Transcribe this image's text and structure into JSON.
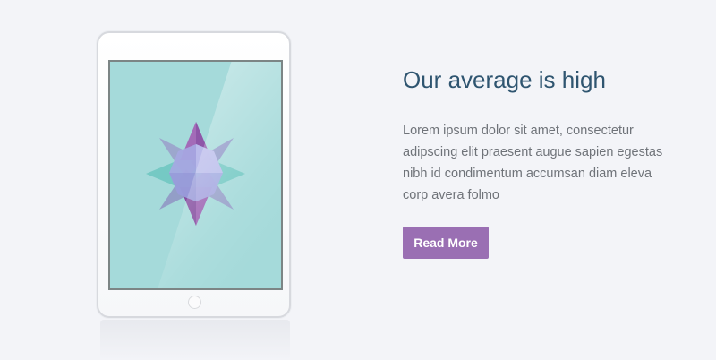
{
  "feature": {
    "heading": "Our average is high",
    "body": "Lorem ipsum dolor sit amet, consectetur adipscing elit praesent augue sapien egestas nibh id condimentum accumsan diam eleva corp avera folmo",
    "cta_label": "Read More"
  },
  "device": {
    "icon": "star-compass-icon"
  },
  "colors": {
    "page_background": "#f3f4f8",
    "heading": "#2f5570",
    "body_text": "#6f7379",
    "button": "#9a6fb3",
    "screen": "#a5dada"
  }
}
